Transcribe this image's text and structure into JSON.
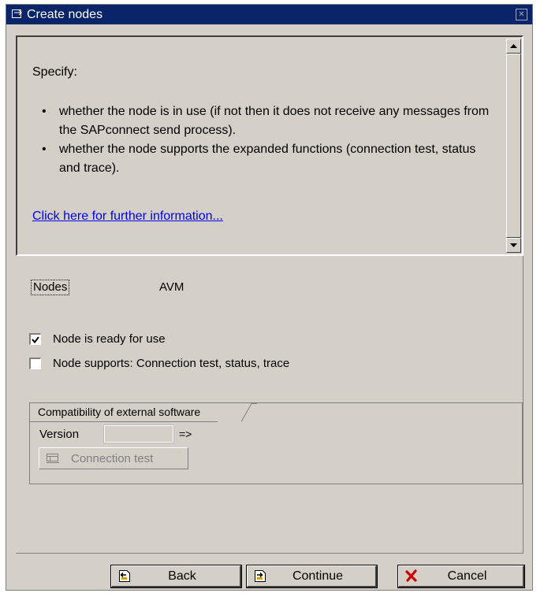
{
  "window": {
    "title": "Create nodes",
    "close_icon": "close-icon"
  },
  "info": {
    "intro": "Specify:",
    "bullets": [
      "whether the node is in use (if not then it does not receive any messages from the SAPconnect send process).",
      "whether the node supports the expanded functions (connection test, status and trace)."
    ],
    "link_text": "Click here for further information..."
  },
  "form": {
    "nodes_label": "Nodes",
    "nodes_value": "AVM",
    "checkbox_ready": {
      "label": "Node is ready for use",
      "checked": true
    },
    "checkbox_supports": {
      "label": "Node supports: Connection test, status, trace",
      "checked": false
    },
    "compat_group": {
      "title": "Compatibility of external software",
      "version_label": "Version",
      "version_value": "",
      "arrow": "=>",
      "connection_test_label": "Connection test"
    }
  },
  "footer": {
    "back_label": "Back",
    "continue_label": "Continue",
    "cancel_label": "Cancel"
  },
  "colors": {
    "titlebar": "#0a246a",
    "dialog_bg": "#d4d0c8",
    "link": "#0000ee",
    "cancel_icon": "#cc0000"
  }
}
